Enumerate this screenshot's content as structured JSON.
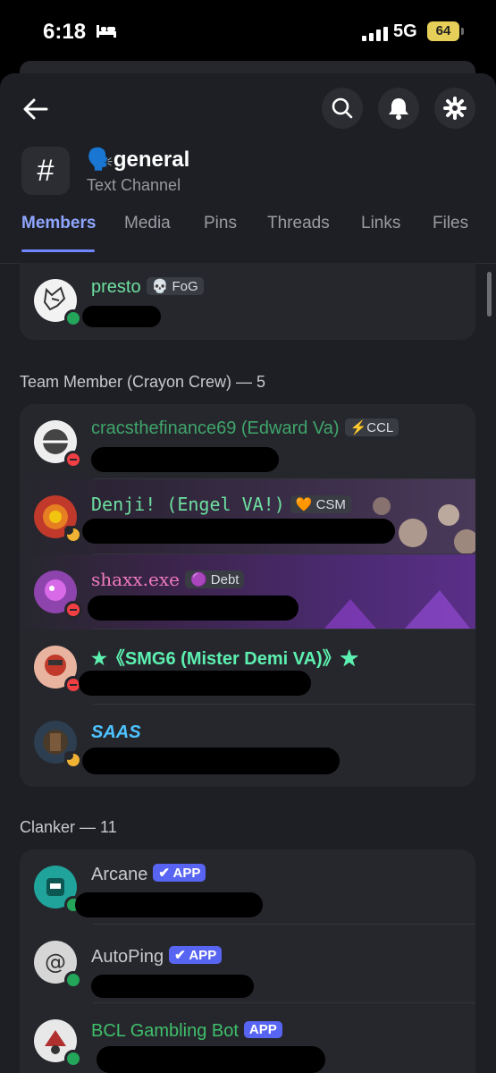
{
  "status": {
    "time": "6:18",
    "network": "5G",
    "battery": "64"
  },
  "header": {
    "channel_name": "general",
    "channel_emoji": "🗣️",
    "channel_type": "Text Channel"
  },
  "tabs": [
    "Members",
    "Media",
    "Pins",
    "Threads",
    "Links",
    "Files"
  ],
  "top_member": {
    "name": "presto",
    "tag": "💀 FoG"
  },
  "team_section": {
    "title": "Team Member (Crayon Crew) — 5"
  },
  "team": [
    {
      "name": "cracsthefinance69 (Edward Va)",
      "tag": "⚡CCL",
      "color": "#3fa56a"
    },
    {
      "name": "Denji! (Engel VA!)",
      "tag": "🧡 CSM",
      "color": "#6ee0a0"
    },
    {
      "name": "shaxx.exe",
      "tag": "🟣 Debt",
      "color": "#f07ac0"
    },
    {
      "name": "★《SMG6 (Mister Demi VA)》★",
      "tag": "",
      "color": "#5cf0b0"
    },
    {
      "name": "SAAS",
      "tag": "",
      "color": "#4ec3ff"
    }
  ],
  "clanker_section": {
    "title": "Clanker — 11"
  },
  "clanker": [
    {
      "name": "Arcane",
      "badge": "✔ APP",
      "color": "#c7c9ce"
    },
    {
      "name": "AutoPing",
      "badge": "✔ APP",
      "color": "#c7c9ce"
    },
    {
      "name": "BCL Gambling Bot",
      "badge": "APP",
      "color": "#3fbf6a"
    }
  ],
  "colors": {
    "accent": "#8fa6ff",
    "online": "#23a55a",
    "dnd": "#f23f43",
    "idle": "#f0b232"
  }
}
